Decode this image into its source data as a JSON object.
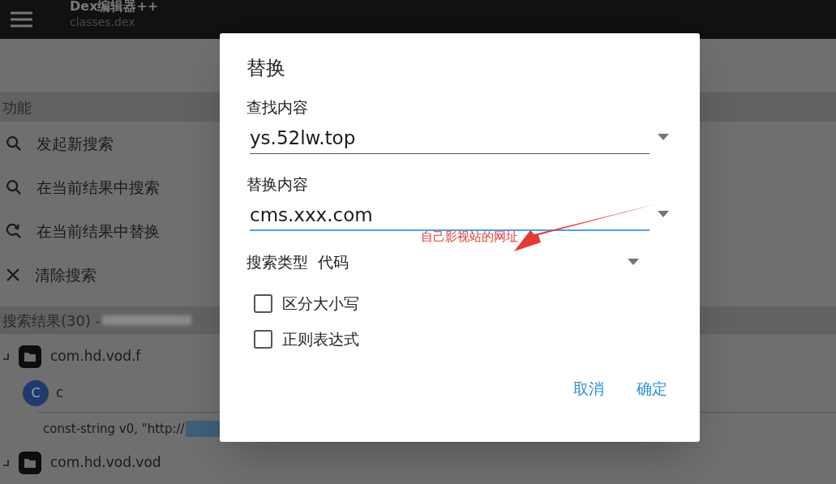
{
  "app_bar": {
    "title": "Dex编辑器++",
    "subtitle": "classes.dex"
  },
  "functions": {
    "header": "功能",
    "items": [
      {
        "kind": "search",
        "label": "发起新搜索"
      },
      {
        "kind": "search",
        "label": "在当前结果中搜索"
      },
      {
        "kind": "replace",
        "label": "在当前结果中替换"
      },
      {
        "kind": "clear",
        "label": "清除搜索"
      }
    ]
  },
  "results": {
    "header": "搜索结果(30) -",
    "items": [
      {
        "kind": "package",
        "label": "com.hd.vod.f",
        "children": [
          {
            "kind": "class",
            "badge": "C",
            "label": "c",
            "children": [
              {
                "kind": "code",
                "label": "const-string v0, \"http://"
              }
            ]
          }
        ]
      },
      {
        "kind": "package",
        "label": "com.hd.vod.vod"
      }
    ]
  },
  "dialog": {
    "title": "替换",
    "fields": [
      {
        "label": "查找内容",
        "value": "ys.52lw.top",
        "focused": false
      },
      {
        "label": "替换内容",
        "value": "cms.xxx.com",
        "focused": true
      }
    ],
    "search_type": {
      "label": "搜索类型",
      "value": "代码"
    },
    "checkboxes": [
      {
        "label": "区分大小写",
        "checked": false
      },
      {
        "label": "正则表达式",
        "checked": false
      }
    ],
    "buttons": [
      "取消",
      "确定"
    ]
  },
  "annotation": {
    "text": "自己影视站的网址"
  }
}
